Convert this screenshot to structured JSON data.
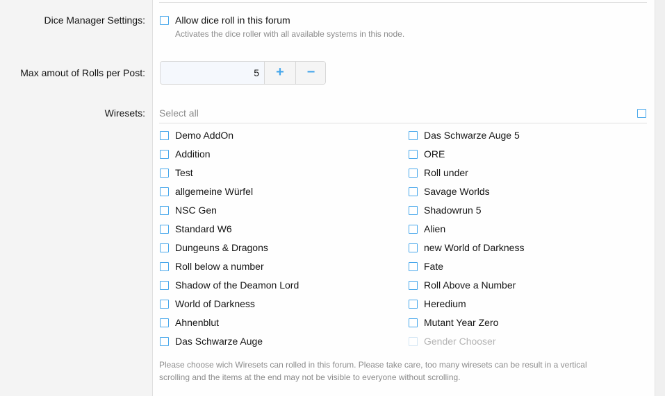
{
  "dice_manager": {
    "label": "Dice Manager Settings:",
    "checkbox_label": "Allow dice roll in this forum",
    "hint": "Activates the dice roller with all available systems in this node."
  },
  "max_rolls": {
    "label": "Max amout of Rolls per Post:",
    "value": "5",
    "plus": "+",
    "minus": "−"
  },
  "wiresets": {
    "label": "Wiresets:",
    "select_all": "Select all",
    "left_column": [
      "Demo AddOn",
      "Addition",
      "Test",
      "allgemeine Würfel",
      "NSC Gen",
      "Standard W6",
      "Dungeuns & Dragons",
      "Roll below a number",
      "Shadow of the Deamon Lord",
      "World of Darkness",
      "Ahnenblut",
      "Das Schwarze Auge"
    ],
    "right_column": [
      "Das Schwarze Auge 5",
      "ORE",
      "Roll under",
      "Savage Worlds",
      "Shadowrun 5",
      "Alien",
      "new World of Darkness",
      "Fate",
      "Roll Above a Number",
      "Heredium",
      "Mutant Year Zero",
      "Gender Chooser"
    ],
    "hint_line1": "Please choose wich Wiresets can rolled in this forum. Please take care, too many wiresets can be result in a vertical",
    "hint_line2": "scrolling and the items at the end may not be visible to everyone without scrolling."
  },
  "colors": {
    "accent": "#47a7eb",
    "disabled_text": "#b3b3b3"
  }
}
